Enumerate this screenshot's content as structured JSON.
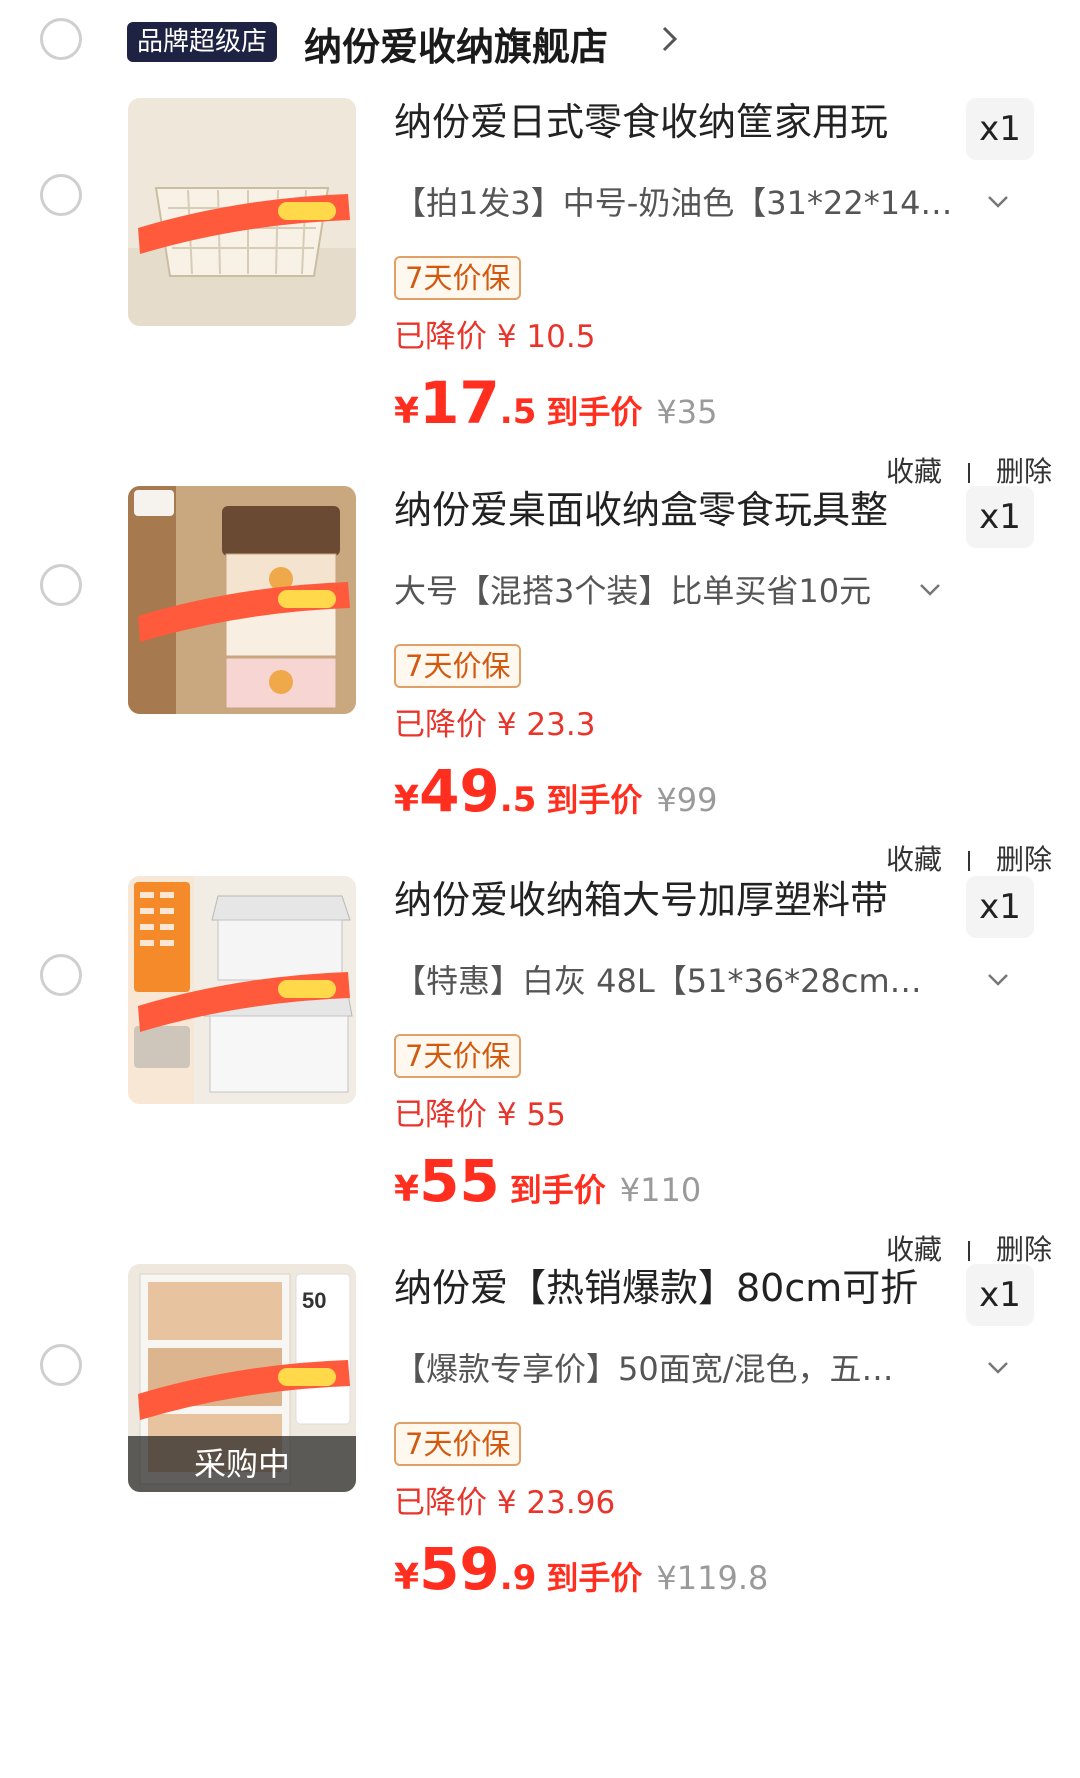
{
  "store": {
    "badge": "品牌超级店",
    "name": "纳份爱收纳旗舰店"
  },
  "items": [
    {
      "title": "纳份爱日式零食收纳筐家用玩",
      "qty": "x1",
      "sku": "【拍1发3】中号-奶油色【31*22*14…",
      "tag": "7天价保",
      "discount": "已降价 ¥ 10.5",
      "price_currency": "¥",
      "price_int": "17",
      "price_dec": ".5",
      "price_label": "到手价",
      "original_price": "¥35",
      "fav": "收藏",
      "del": "删除",
      "thumb_overlay": ""
    },
    {
      "title": "纳份爱桌面收纳盒零食玩具整",
      "qty": "x1",
      "sku": "大号【混搭3个装】比单买省10元",
      "tag": "7天价保",
      "discount": "已降价 ¥ 23.3",
      "price_currency": "¥",
      "price_int": "49",
      "price_dec": ".5",
      "price_label": "到手价",
      "original_price": "¥99",
      "fav": "收藏",
      "del": "删除",
      "thumb_overlay": ""
    },
    {
      "title": "纳份爱收纳箱大号加厚塑料带",
      "qty": "x1",
      "sku": "【特惠】白灰 48L【51*36*28cm…",
      "tag": "7天价保",
      "discount": "已降价 ¥ 55",
      "price_currency": "¥",
      "price_int": "55",
      "price_dec": "",
      "price_label": "到手价",
      "original_price": "¥110",
      "fav": "收藏",
      "del": "删除",
      "thumb_overlay": ""
    },
    {
      "title": "纳份爱【热销爆款】80cm可折",
      "qty": "x1",
      "sku": "【爆款专享价】50面宽/混色，五…",
      "tag": "7天价保",
      "discount": "已降价 ¥ 23.96",
      "price_currency": "¥",
      "price_int": "59",
      "price_dec": ".9",
      "price_label": "到手价",
      "original_price": "¥119.8",
      "fav": "",
      "del": "",
      "thumb_overlay": "采购中"
    }
  ],
  "colors": {
    "price_red": "#ff2e1f",
    "badge_bg": "#1f2343",
    "tag_border": "#e0a066"
  },
  "icons": {
    "chevron_right": "chevron-right-icon",
    "chevron_down": "chevron-down-icon"
  }
}
